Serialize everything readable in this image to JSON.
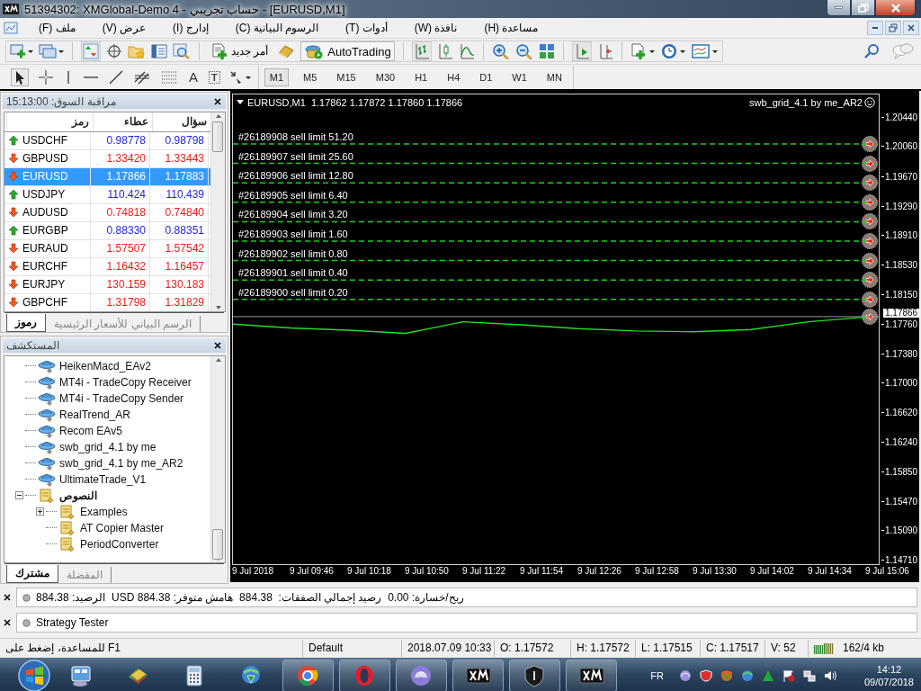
{
  "window": {
    "title": "51394302: XMGlobal-Demo 4 - حساب تجريبي - [EURUSD,M1]"
  },
  "menu": [
    "مساعدة (H)",
    "نافذة (W)",
    "أدوات (T)",
    "الرسوم البيانية (C)",
    "إدارج (I)",
    "عرض (V)",
    "ملف (F)"
  ],
  "toolbar": {
    "new_order": "أمر جديد",
    "autotrading": "AutoTrading",
    "text_tool": "A",
    "label_tool": "T"
  },
  "timeframes": [
    {
      "label": "M1",
      "selected": true
    },
    {
      "label": "M5",
      "selected": false
    },
    {
      "label": "M15",
      "selected": false
    },
    {
      "label": "M30",
      "selected": false
    },
    {
      "label": "H1",
      "selected": false
    },
    {
      "label": "H4",
      "selected": false
    },
    {
      "label": "D1",
      "selected": false
    },
    {
      "label": "W1",
      "selected": false
    },
    {
      "label": "MN",
      "selected": false
    }
  ],
  "market_watch": {
    "title": "مراقبة السوق: 15:13:00",
    "columns": [
      "سؤال",
      "عطاء",
      "رمز"
    ],
    "rows": [
      {
        "symbol": "USDCHF",
        "bid": "0.98778",
        "ask": "0.98798",
        "up": true,
        "selected": false
      },
      {
        "symbol": "GBPUSD",
        "bid": "1.33420",
        "ask": "1.33443",
        "up": false,
        "selected": false
      },
      {
        "symbol": "EURUSD",
        "bid": "1.17866",
        "ask": "1.17883",
        "up": false,
        "selected": true
      },
      {
        "symbol": "USDJPY",
        "bid": "110.424",
        "ask": "110.439",
        "up": true,
        "selected": false
      },
      {
        "symbol": "AUDUSD",
        "bid": "0.74818",
        "ask": "0.74840",
        "up": false,
        "selected": false
      },
      {
        "symbol": "EURGBP",
        "bid": "0.88330",
        "ask": "0.88351",
        "up": true,
        "selected": false
      },
      {
        "symbol": "EURAUD",
        "bid": "1.57507",
        "ask": "1.57542",
        "up": false,
        "selected": false
      },
      {
        "symbol": "EURCHF",
        "bid": "1.16432",
        "ask": "1.16457",
        "up": false,
        "selected": false
      },
      {
        "symbol": "EURJPY",
        "bid": "130.159",
        "ask": "130.183",
        "up": false,
        "selected": false
      },
      {
        "symbol": "GBPCHF",
        "bid": "1.31798",
        "ask": "1.31829",
        "up": false,
        "selected": false
      }
    ],
    "tabs": [
      {
        "label": "الرسم البياني للأسعار الرئيسية",
        "selected": false
      },
      {
        "label": "رموز",
        "selected": true
      }
    ]
  },
  "navigator": {
    "title": "المستكشف",
    "items": [
      {
        "kind": "group",
        "children": [
          {
            "label": "HeikenMacd_EAv2",
            "kind": "expert"
          },
          {
            "label": "MT4i - TradeCopy Receiver",
            "kind": "expert"
          },
          {
            "label": "MT4i - TradeCopy Sender",
            "kind": "expert"
          },
          {
            "label": "RealTrend_AR",
            "kind": "expert"
          },
          {
            "label": "Recom EAv5",
            "kind": "expert"
          },
          {
            "label": "swb_grid_4.1 by me",
            "kind": "expert"
          },
          {
            "label": "swb_grid_4.1 by me_AR2",
            "kind": "expert"
          },
          {
            "label": "UltimateTrade_V1",
            "kind": "expert"
          }
        ]
      },
      {
        "label": "النصوص",
        "kind": "folder",
        "expanded": true,
        "children": [
          {
            "label": "Examples",
            "kind": "folder",
            "expanded": false
          },
          {
            "label": "AT Copier Master",
            "kind": "script"
          },
          {
            "label": "PeriodConverter",
            "kind": "script"
          }
        ]
      }
    ],
    "tabs": [
      {
        "label": "المفضلة",
        "selected": false
      },
      {
        "label": "مشترك",
        "selected": true
      }
    ]
  },
  "chart": {
    "symbol_info": "EURUSD,M1  1.17862 1.17872 1.17860 1.17866",
    "expert": "swb_grid_4.1 by me_AR2",
    "orders": [
      "#26189908 sell limit 51.20",
      "#26189907 sell limit 25.60",
      "#26189906 sell limit 12.80",
      "#26189905 sell limit 6.40",
      "#26189904 sell limit 3.20",
      "#26189903 sell limit 1.60",
      "#26189902 sell limit 0.80",
      "#26189901 sell limit 0.40",
      "#26189900 sell limit 0.20"
    ],
    "current_price": "1.17866",
    "chart_data": {
      "type": "line",
      "categories": [
        "9 Jul 2018",
        "9 Jul 09:46",
        "9 Jul 10:18",
        "9 Jul 10:50",
        "9 Jul 11:22",
        "9 Jul 11:54",
        "9 Jul 12:26",
        "9 Jul 12:58",
        "9 Jul 13:30",
        "9 Jul 14:02",
        "9 Jul 14:34",
        "9 Jul 15:06"
      ],
      "series": [
        {
          "color": "#21e021",
          "values": [
            1.1777,
            1.1772,
            1.1769,
            1.1765,
            1.178,
            1.1776,
            1.1771,
            1.1768,
            1.1767,
            1.177,
            1.178,
            1.1786
          ]
        }
      ],
      "ylim": [
        1.14664,
        1.2074
      ],
      "yticks": [
        {
          "value": 1.2044,
          "label": "1.20440"
        },
        {
          "value": 1.2006,
          "label": "1.20060"
        },
        {
          "value": 1.1967,
          "label": "1.19670"
        },
        {
          "value": 1.1929,
          "label": "1.19290"
        },
        {
          "value": 1.1891,
          "label": "1.18910"
        },
        {
          "value": 1.1853,
          "label": "1.18530"
        },
        {
          "value": 1.1815,
          "label": "1.18150"
        },
        {
          "value": 1.1776,
          "label": "1.17760"
        },
        {
          "value": 1.1738,
          "label": "1.17380"
        },
        {
          "value": 1.17,
          "label": "1.17000"
        },
        {
          "value": 1.1662,
          "label": "1.16620"
        },
        {
          "value": 1.1624,
          "label": "1.16240"
        },
        {
          "value": 1.1585,
          "label": "1.15850"
        },
        {
          "value": 1.1547,
          "label": "1.15470"
        },
        {
          "value": 1.1509,
          "label": "1.15090"
        },
        {
          "value": 1.1471,
          "label": "1.14710"
        }
      ]
    }
  },
  "terminal": {
    "account": "ربح/خسارة: 0.00  رصيد إجمالي الصفقات:  884.38  هامش متوفر: 884.38 USD  الرصيد: 884.38",
    "tester": "Strategy Tester"
  },
  "status_bar": {
    "help": "للمساعدة، إضغط على F1",
    "profile": "Default",
    "time": "2018.07.09 10:33",
    "open": "O: 1.17572",
    "high": "H: 1.17572",
    "low": "L: 1.17515",
    "close": "C: 1.17517",
    "volume": "V: 52",
    "traffic": "162/4 kb"
  },
  "taskbar": {
    "apps": [
      {
        "running": false
      },
      {
        "running": false
      },
      {
        "running": false
      },
      {
        "running": false
      },
      {
        "running": true
      },
      {
        "running": true
      },
      {
        "running": true
      },
      {
        "running": true
      },
      {
        "running": true
      },
      {
        "running": true
      }
    ],
    "language": "FR",
    "time": "14:12",
    "date": "09/07/2018"
  }
}
